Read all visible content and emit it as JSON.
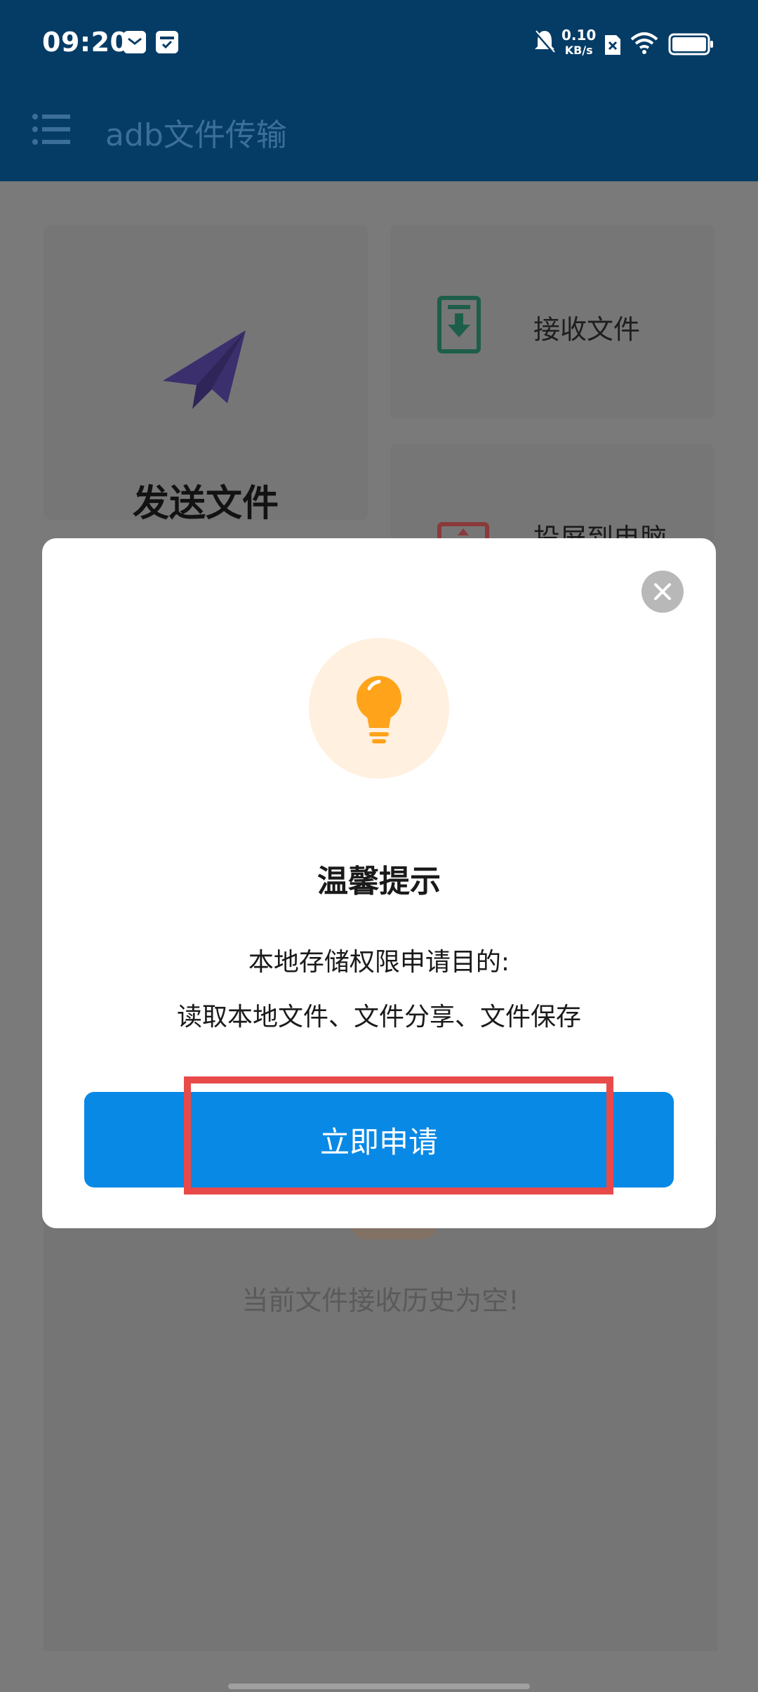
{
  "status_bar": {
    "time": "09:20",
    "net_speed_value": "0.10",
    "net_speed_unit": "KB/s",
    "icons": [
      "mail-icon",
      "calendar-check-icon",
      "mute-bell-icon",
      "no-sim-icon",
      "wifi-icon",
      "battery-icon"
    ]
  },
  "app_bar": {
    "menu_icon": "hamburger-menu-icon",
    "title": "adb文件传输"
  },
  "background": {
    "send_card_label": "发送文件",
    "receive_card_label": "接收文件",
    "back_card_label_partial": "投屏到电脑",
    "empty_history_text": "当前文件接收历史为空!"
  },
  "dialog": {
    "icon": "lightbulb-icon",
    "close_icon": "close-icon",
    "title": "温馨提示",
    "line1": "本地存储权限申请目的:",
    "line2": "读取本地文件、文件分享、文件保存",
    "primary_button": "立即申请"
  },
  "colors": {
    "app_bar": "#053c66",
    "primary_button": "#0889e6",
    "highlight": "#e84a4a",
    "bulb": "#ffa31a",
    "bulb_bg": "#fff0df"
  }
}
